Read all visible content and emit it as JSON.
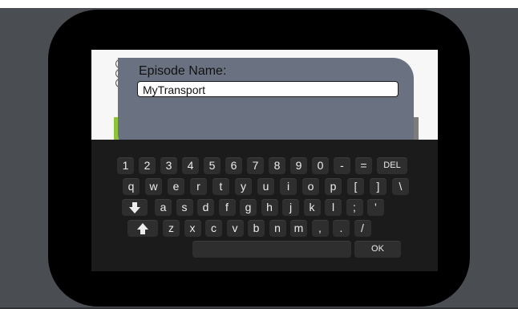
{
  "dialog": {
    "label": "Episode Name:",
    "input_value": "MyTransport"
  },
  "keyboard": {
    "row1": [
      "1",
      "2",
      "3",
      "4",
      "5",
      "6",
      "7",
      "8",
      "9",
      "0",
      "-",
      "=",
      "DEL"
    ],
    "row2": [
      "q",
      "w",
      "e",
      "r",
      "t",
      "y",
      "u",
      "i",
      "o",
      "p",
      "[",
      "]",
      "\\"
    ],
    "row3": [
      "a",
      "s",
      "d",
      "f",
      "g",
      "h",
      "j",
      "k",
      "l",
      ";",
      "'"
    ],
    "row4": [
      "z",
      "x",
      "c",
      "v",
      "b",
      "n",
      "m",
      ",",
      ".",
      "/"
    ],
    "ok_label": "OK",
    "icons": {
      "caps": "arrow-down-icon",
      "shift": "arrow-up-icon"
    }
  },
  "colors": {
    "dialog": "#6a7282",
    "keyboard": "#1b1b1b",
    "key": "#2e2e2e",
    "accent_green": "#8fc43a"
  }
}
